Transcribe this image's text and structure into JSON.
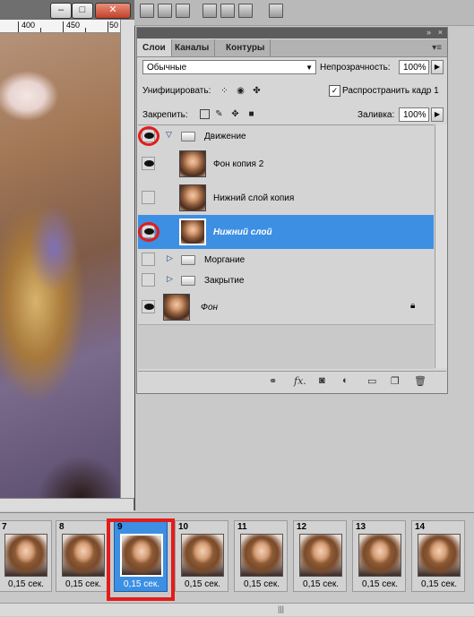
{
  "document": {
    "ruler_labels": [
      "400",
      "450",
      "50"
    ],
    "window_buttons": {
      "minimize": "–",
      "restore": "□",
      "close": "✕"
    }
  },
  "panel": {
    "tabs": [
      "Слои",
      "Каналы",
      "Контуры"
    ],
    "blend_mode": "Обычные",
    "opacity_label": "Непрозрачность:",
    "opacity_value": "100%",
    "unify_label": "Унифицировать:",
    "propagate_label": "Распространить кадр 1",
    "propagate_checked": true,
    "lock_label": "Закрепить:",
    "fill_label": "Заливка:",
    "fill_value": "100%",
    "layers": [
      {
        "name": "Движение",
        "type": "group",
        "expanded": true,
        "visible": true,
        "highlighted": true,
        "bold": false,
        "italic": false
      },
      {
        "name": "Фон копия 2",
        "type": "layer",
        "visible": true,
        "selected": false,
        "bold": false,
        "italic": false
      },
      {
        "name": "Нижний слой копия",
        "type": "layer",
        "visible": false,
        "selected": false,
        "bold": false,
        "italic": false
      },
      {
        "name": "Нижний слой",
        "type": "layer",
        "visible": true,
        "selected": true,
        "highlighted": true,
        "bold": true,
        "italic": true
      },
      {
        "name": "Моргание",
        "type": "group",
        "expanded": false,
        "visible": false,
        "bold": false,
        "italic": false
      },
      {
        "name": "Закрытие",
        "type": "group",
        "expanded": false,
        "visible": false,
        "bold": false,
        "italic": false
      },
      {
        "name": "Фон",
        "type": "layer",
        "visible": true,
        "locked": true,
        "bold": false,
        "italic": true
      }
    ]
  },
  "timeline": {
    "frames": [
      {
        "number": "7",
        "delay": "0,15 сек."
      },
      {
        "number": "8",
        "delay": "0,15 сек."
      },
      {
        "number": "9",
        "delay": "0,15 сек.",
        "selected": true,
        "highlighted": true
      },
      {
        "number": "10",
        "delay": "0,15 сек."
      },
      {
        "number": "11",
        "delay": "0,15 сек."
      },
      {
        "number": "12",
        "delay": "0,15 сек."
      },
      {
        "number": "13",
        "delay": "0,15 сек."
      },
      {
        "number": "14",
        "delay": "0,15 сек."
      }
    ]
  },
  "colors": {
    "selection": "#3d8fe3",
    "annotation_red": "#e41b1b"
  }
}
